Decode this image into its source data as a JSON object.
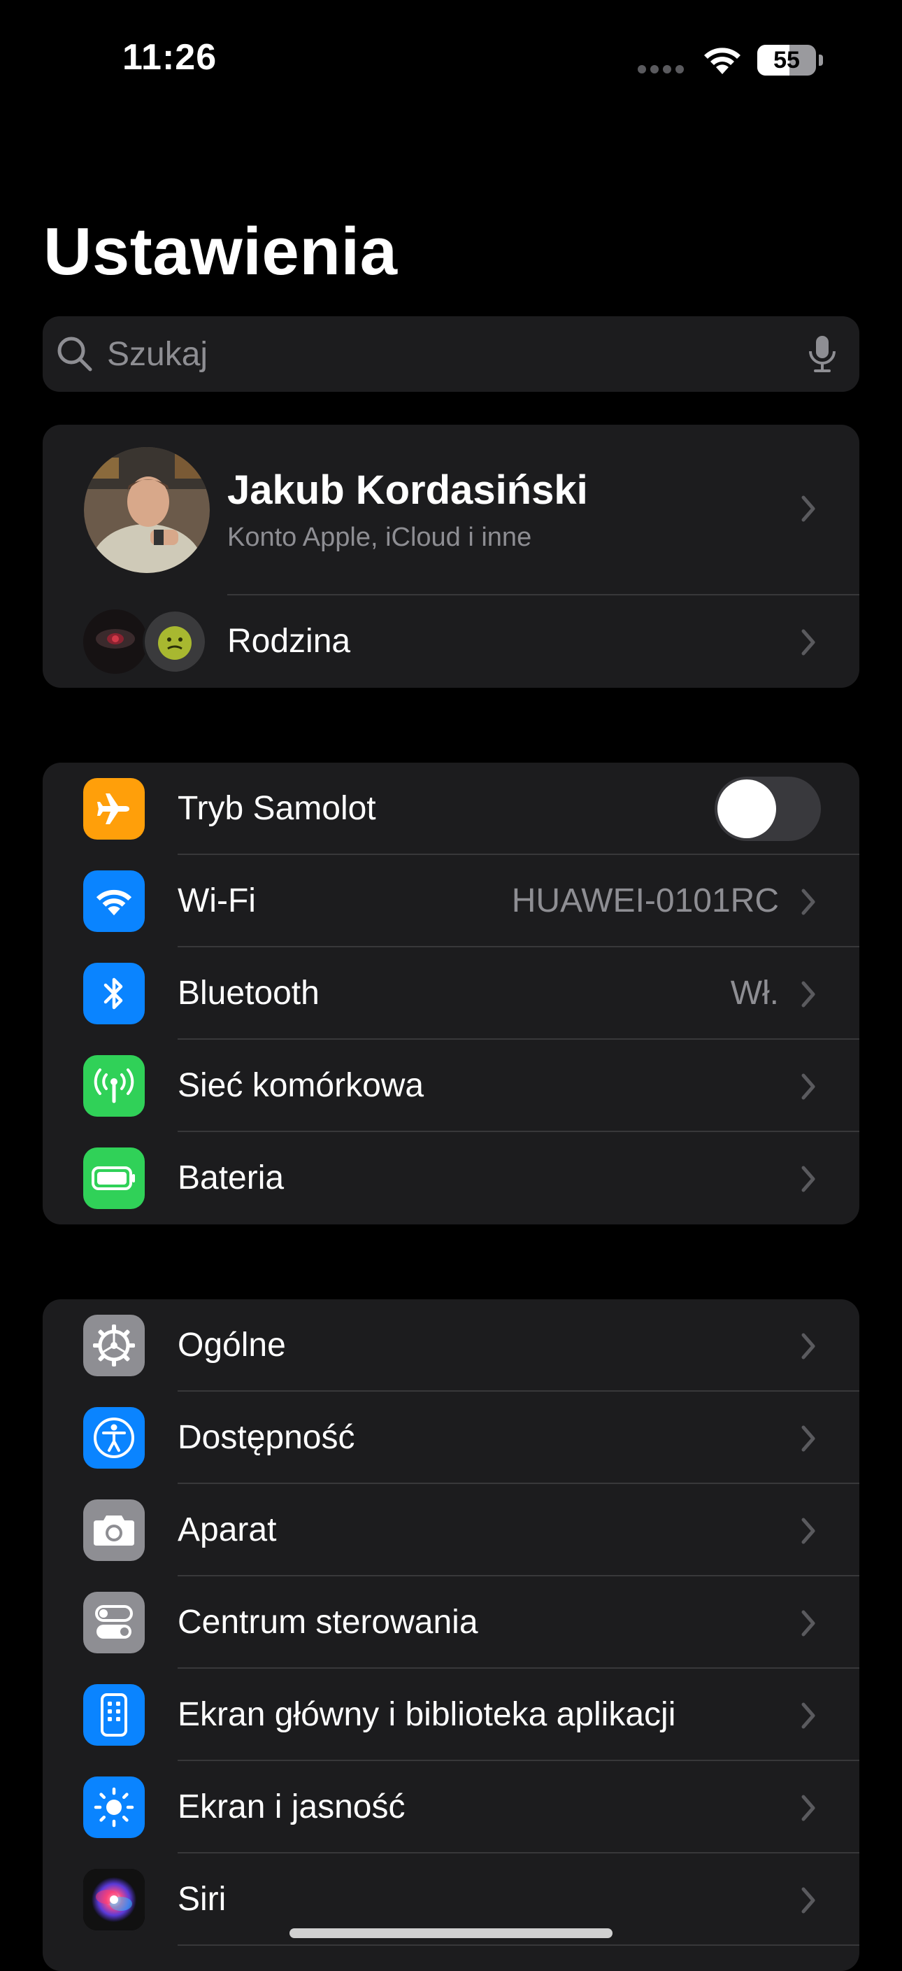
{
  "status_bar": {
    "time": "11:26",
    "battery_percent": "55",
    "battery_level": 0.55
  },
  "title": "Ustawienia",
  "search": {
    "placeholder": "Szukaj",
    "value": ""
  },
  "profile": {
    "name": "Jakub Kordasiński",
    "subtitle": "Konto Apple, iCloud i inne",
    "family_label": "Rodzina"
  },
  "connectivity": [
    {
      "label": "Tryb Samolot",
      "icon": "airplane-icon",
      "color": "#ff9f0a",
      "toggle": false
    },
    {
      "label": "Wi-Fi",
      "icon": "wifi-icon",
      "color": "#0a84ff",
      "value": "HUAWEI-0101RC"
    },
    {
      "label": "Bluetooth",
      "icon": "bluetooth-icon",
      "color": "#0a84ff",
      "value": "Wł."
    },
    {
      "label": "Sieć komórkowa",
      "icon": "cellular-icon",
      "color": "#30d158"
    },
    {
      "label": "Bateria",
      "icon": "battery-icon",
      "color": "#30d158"
    }
  ],
  "general": [
    {
      "label": "Ogólne",
      "icon": "gear-icon",
      "color": "#8e8e93"
    },
    {
      "label": "Dostępność",
      "icon": "accessibility-icon",
      "color": "#0a84ff"
    },
    {
      "label": "Aparat",
      "icon": "camera-icon",
      "color": "#8e8e93"
    },
    {
      "label": "Centrum sterowania",
      "icon": "control-center-icon",
      "color": "#8e8e93"
    },
    {
      "label": "Ekran główny i biblioteka aplikacji",
      "icon": "home-screen-icon",
      "color": "#0a84ff"
    },
    {
      "label": "Ekran i jasność",
      "icon": "brightness-icon",
      "color": "#0a84ff"
    },
    {
      "label": "Siri",
      "icon": "siri-icon",
      "color": "#bf5af2"
    }
  ]
}
